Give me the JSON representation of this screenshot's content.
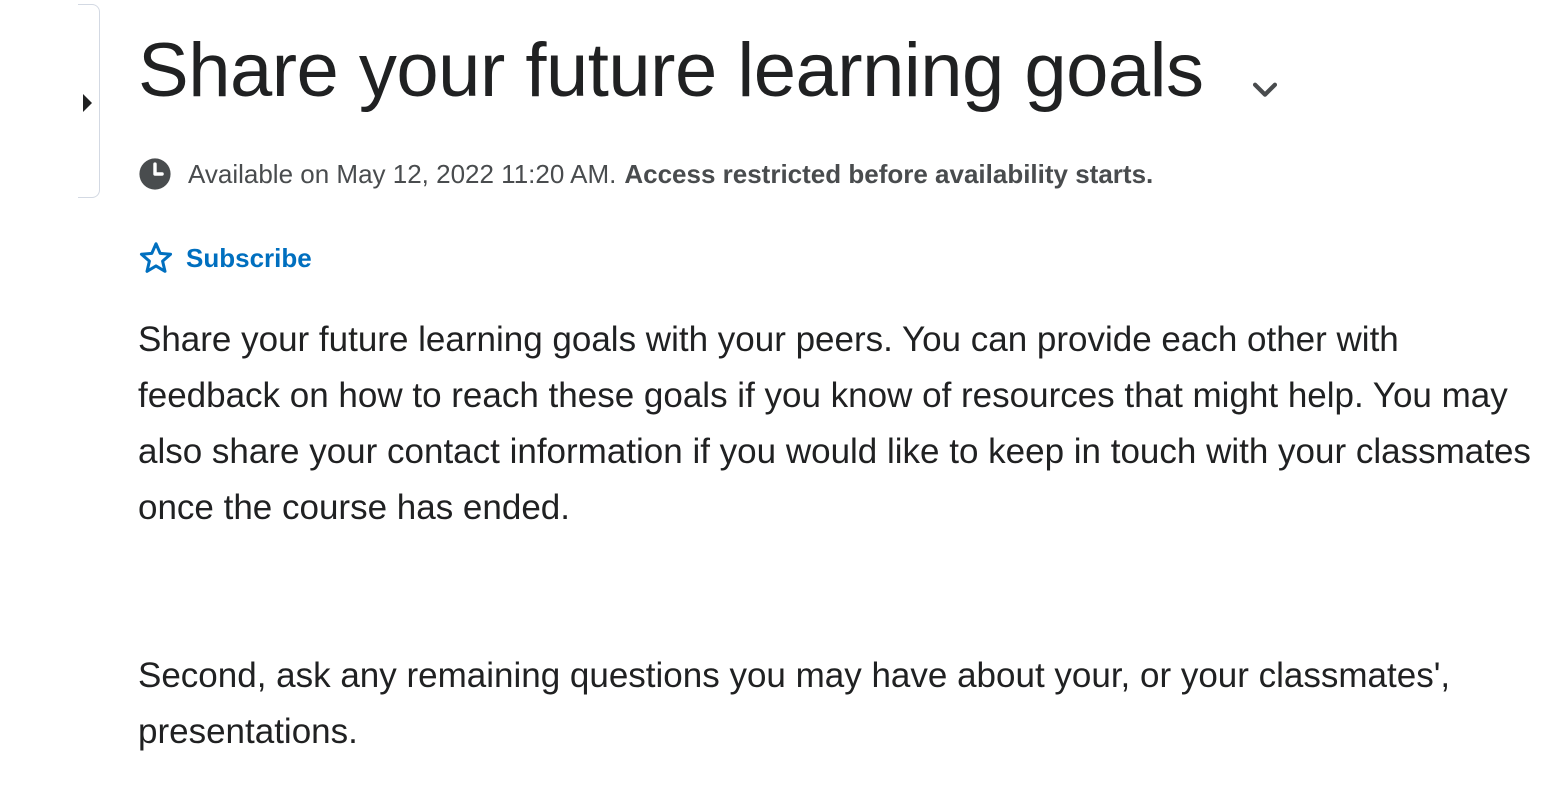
{
  "title": "Share your future learning goals",
  "availability": {
    "text": "Available on May 12, 2022 11:20 AM.",
    "restriction": "Access restricted before availability starts."
  },
  "subscribe": {
    "label": "Subscribe"
  },
  "body": {
    "paragraph1": "Share your future learning goals with your peers. You can provide each other with feedback on how to reach these goals if you know of resources that might help. You may also share your contact information if you would like to keep in touch with your classmates once the course has ended.",
    "paragraph2": "Second, ask any remaining questions you may have about your, or your classmates', presentations."
  },
  "icons": {
    "side_toggle": "caret-right-icon",
    "title_menu": "chevron-down-icon",
    "availability": "clock-icon",
    "subscribe": "star-outline-icon"
  },
  "colors": {
    "text": "#202122",
    "secondary_text": "#494c4e",
    "link": "#006fbf"
  }
}
